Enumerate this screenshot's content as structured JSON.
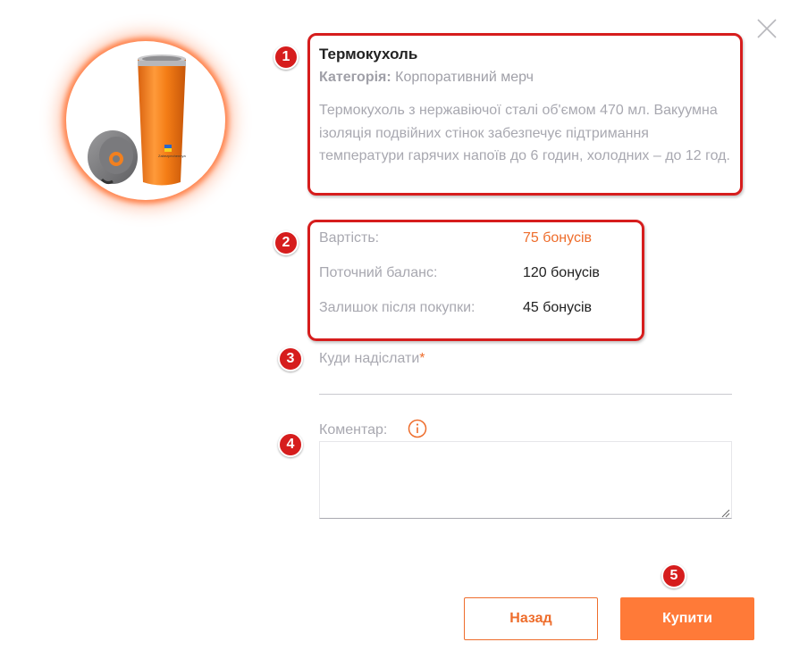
{
  "dialog": {
    "close_icon": "close-icon",
    "product": {
      "title": "Термокухоль",
      "category_key": "Категорія:",
      "category_value": "Корпоративний мерч",
      "description": "Термокухоль з нержавіючої сталі об'ємом 470 мл. Вакуумна ізоляція подвійних стінок забезпечує підтримання температури гарячих напоїв до 6 годин, холодних – до 12 год.",
      "image_icon": "thermo-mug-image",
      "image_brand_text": "Zabezpechennya"
    },
    "pricing": {
      "cost_label": "Вартість:",
      "cost_value": "75 бонусів",
      "balance_label": "Поточний баланс:",
      "balance_value": "120 бонусів",
      "remaining_label": "Залишок після покупки:",
      "remaining_value": "45 бонусів"
    },
    "form": {
      "address_label": "Куди надіслати",
      "required_mark": "*",
      "address_value": "",
      "comment_label": "Коментар:",
      "info_icon": "info-icon",
      "comment_value": ""
    },
    "buttons": {
      "back_label": "Назад",
      "buy_label": "Купити"
    }
  },
  "annotations": [
    "1",
    "2",
    "3",
    "4",
    "5"
  ],
  "colors": {
    "accent": "#ee6d2c",
    "accent_button": "#ff7a38",
    "annotation_red": "#d61d1d",
    "muted_text": "#a8a8b0"
  }
}
